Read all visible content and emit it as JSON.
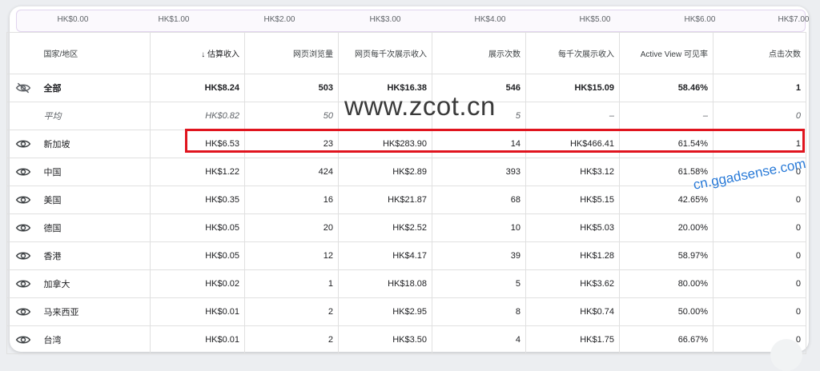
{
  "axis_ticks": [
    "HK$0.00",
    "HK$1.00",
    "HK$2.00",
    "HK$3.00",
    "HK$4.00",
    "HK$5.00",
    "HK$6.00",
    "HK$7.00"
  ],
  "table": {
    "headers": {
      "country": "国家/地区",
      "sort_arrow": "↓",
      "earnings": "估算收入",
      "pageviews": "网页浏览量",
      "page_rpm": "网页每千次展示收入",
      "impressions": "展示次数",
      "impression_rpm": "每千次展示收入",
      "active_view": "Active View 可见率",
      "clicks": "点击次数"
    },
    "total": {
      "country": "全部",
      "earnings": "HK$8.24",
      "pageviews": "503",
      "page_rpm": "HK$16.38",
      "impressions": "546",
      "impression_rpm": "HK$15.09",
      "active_view": "58.46%",
      "clicks": "1"
    },
    "average": {
      "country": "平均",
      "earnings": "HK$0.82",
      "pageviews": "50",
      "page_rpm": "",
      "impressions": "5",
      "impression_rpm": "–",
      "active_view": "–",
      "clicks": "0"
    },
    "rows": [
      {
        "country": "新加坡",
        "earnings": "HK$6.53",
        "pageviews": "23",
        "page_rpm": "HK$283.90",
        "impressions": "14",
        "impression_rpm": "HK$466.41",
        "active_view": "61.54%",
        "clicks": "1"
      },
      {
        "country": "中国",
        "earnings": "HK$1.22",
        "pageviews": "424",
        "page_rpm": "HK$2.89",
        "impressions": "393",
        "impression_rpm": "HK$3.12",
        "active_view": "61.58%",
        "clicks": "0"
      },
      {
        "country": "美国",
        "earnings": "HK$0.35",
        "pageviews": "16",
        "page_rpm": "HK$21.87",
        "impressions": "68",
        "impression_rpm": "HK$5.15",
        "active_view": "42.65%",
        "clicks": "0"
      },
      {
        "country": "德国",
        "earnings": "HK$0.05",
        "pageviews": "20",
        "page_rpm": "HK$2.52",
        "impressions": "10",
        "impression_rpm": "HK$5.03",
        "active_view": "20.00%",
        "clicks": "0"
      },
      {
        "country": "香港",
        "earnings": "HK$0.05",
        "pageviews": "12",
        "page_rpm": "HK$4.17",
        "impressions": "39",
        "impression_rpm": "HK$1.28",
        "active_view": "58.97%",
        "clicks": "0"
      },
      {
        "country": "加拿大",
        "earnings": "HK$0.02",
        "pageviews": "1",
        "page_rpm": "HK$18.08",
        "impressions": "5",
        "impression_rpm": "HK$3.62",
        "active_view": "80.00%",
        "clicks": "0"
      },
      {
        "country": "马来西亚",
        "earnings": "HK$0.01",
        "pageviews": "2",
        "page_rpm": "HK$2.95",
        "impressions": "8",
        "impression_rpm": "HK$0.74",
        "active_view": "50.00%",
        "clicks": "0"
      },
      {
        "country": "台湾",
        "earnings": "HK$0.01",
        "pageviews": "2",
        "page_rpm": "HK$3.50",
        "impressions": "4",
        "impression_rpm": "HK$1.75",
        "active_view": "66.67%",
        "clicks": "0"
      }
    ]
  },
  "watermarks": {
    "primary": "www.zcot.cn",
    "secondary": "cn.ggadsense.com"
  },
  "colors": {
    "highlight": "#e0141e",
    "watermark_secondary": "#2a7bd8"
  }
}
